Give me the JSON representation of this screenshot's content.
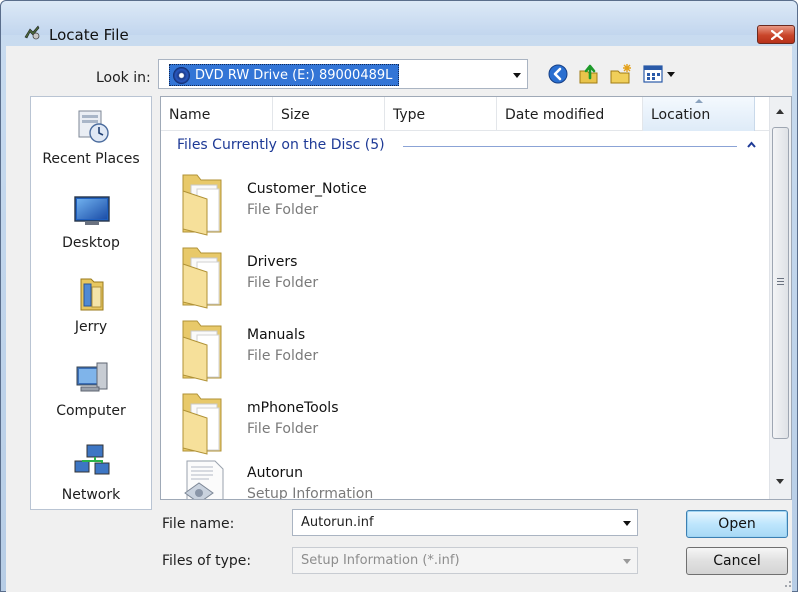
{
  "window": {
    "title": "Locate File"
  },
  "toolbar": {
    "look_in_label": "Look in:",
    "look_in_value": "DVD RW Drive (E:) 89000489L",
    "buttons": [
      "back-icon",
      "up-folder-icon",
      "new-folder-icon",
      "views-menu-icon"
    ]
  },
  "places": [
    {
      "label": "Recent Places",
      "icon": "recent-places-icon"
    },
    {
      "label": "Desktop",
      "icon": "desktop-icon"
    },
    {
      "label": "Jerry",
      "icon": "user-folder-icon"
    },
    {
      "label": "Computer",
      "icon": "computer-icon"
    },
    {
      "label": "Network",
      "icon": "network-icon"
    }
  ],
  "columns": [
    "Name",
    "Size",
    "Type",
    "Date modified",
    "Location"
  ],
  "group": {
    "label": "Files Currently on the Disc (5)"
  },
  "files": [
    {
      "name": "Customer_Notice",
      "kind": "File Folder",
      "icon": "folder-icon"
    },
    {
      "name": "Drivers",
      "kind": "File Folder",
      "icon": "folder-icon"
    },
    {
      "name": "Manuals",
      "kind": "File Folder",
      "icon": "folder-icon"
    },
    {
      "name": "mPhoneTools",
      "kind": "File Folder",
      "icon": "folder-icon"
    },
    {
      "name": "Autorun",
      "kind": "Setup Information",
      "icon": "setup-file-icon"
    }
  ],
  "form": {
    "file_name_label": "File name:",
    "file_name_value": "Autorun.inf",
    "file_type_label": "Files of type:",
    "file_type_value": "Setup Information (*.inf)",
    "open_label": "Open",
    "cancel_label": "Cancel"
  },
  "colors": {
    "selection": "#3375d6",
    "group_text": "#1e3a96",
    "close_button": "#c9452a"
  }
}
